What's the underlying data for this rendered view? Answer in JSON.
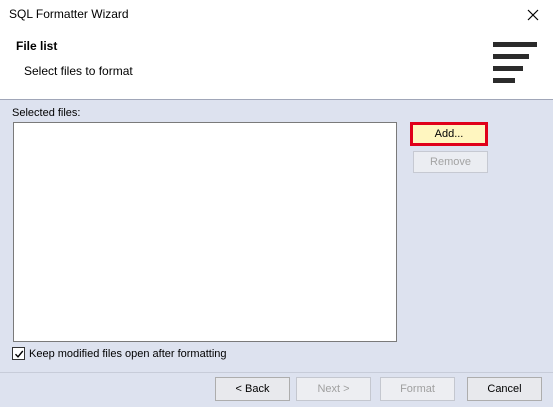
{
  "window": {
    "title": "SQL Formatter Wizard"
  },
  "header": {
    "title": "File list",
    "subtitle": "Select files to format",
    "icon": "text-align-left-icon"
  },
  "content": {
    "selected_files_label": "Selected files:",
    "files": [],
    "add_label": "Add...",
    "remove_label": "Remove",
    "keep_open_label": "Keep modified files open after formatting",
    "keep_open_checked": true
  },
  "footer": {
    "back_label": "< Back",
    "next_label": "Next >",
    "format_label": "Format",
    "cancel_label": "Cancel"
  },
  "colors": {
    "highlight_border": "#e0001a",
    "highlight_fill": "#fff6c0",
    "panel_bg": "#dde2ef"
  }
}
